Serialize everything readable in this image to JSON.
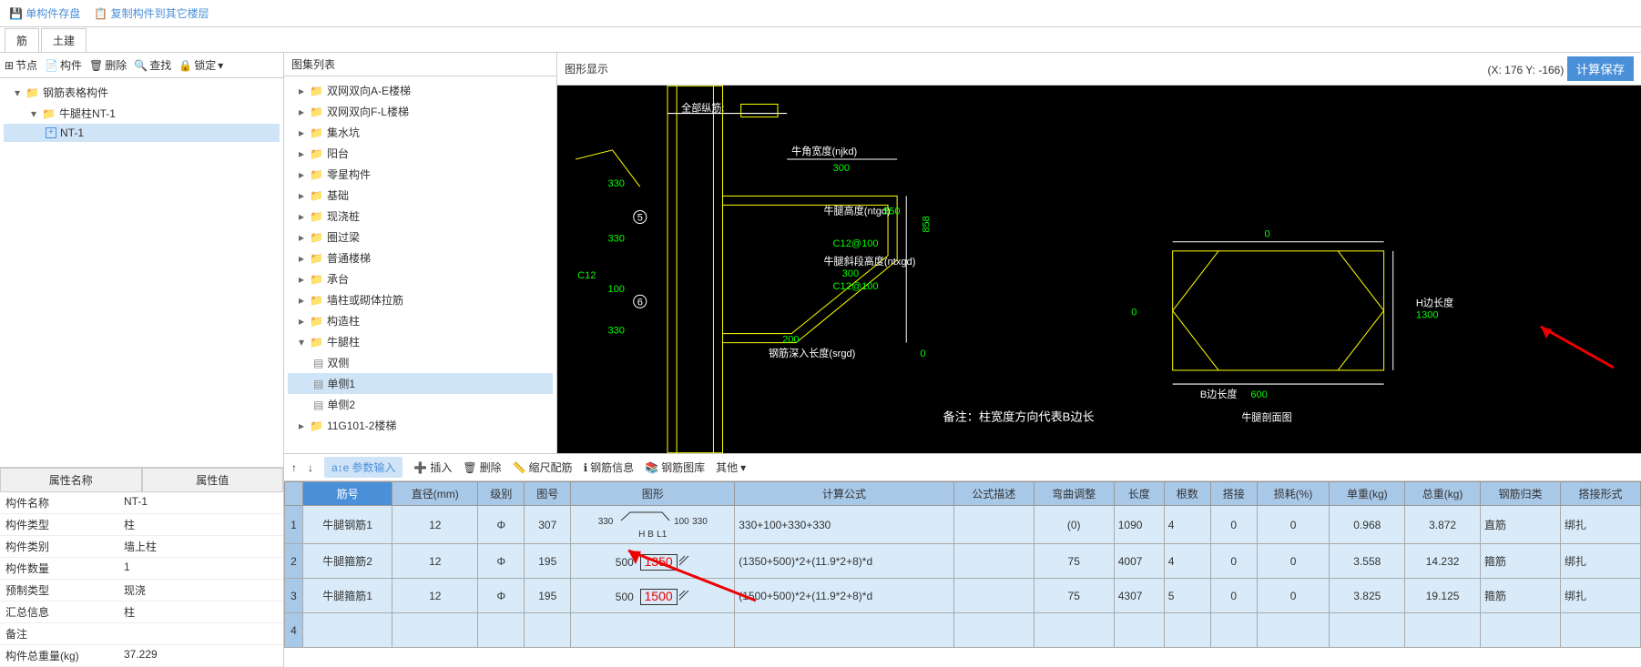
{
  "top_bar": {
    "save": "单构件存盘",
    "copy": "复制构件到其它楼层"
  },
  "tabs": {
    "rebar": "筋",
    "civil": "土建"
  },
  "toolbar": {
    "node": "节点",
    "component": "构件",
    "delete": "删除",
    "search": "查找",
    "lock": "锁定"
  },
  "left_tree": {
    "root": "钢筋表格构件",
    "child1": "牛腿柱NT-1",
    "leaf": "NT-1"
  },
  "props": {
    "header_name": "属性名称",
    "header_value": "属性值",
    "rows": [
      {
        "name": "构件名称",
        "value": "NT-1"
      },
      {
        "name": "构件类型",
        "value": "柱"
      },
      {
        "name": "构件类别",
        "value": "墙上柱"
      },
      {
        "name": "构件数量",
        "value": "1"
      },
      {
        "name": "预制类型",
        "value": "现浇"
      },
      {
        "name": "汇总信息",
        "value": "柱"
      },
      {
        "name": "备注",
        "value": ""
      },
      {
        "name": "构件总重量(kg)",
        "value": "37.229"
      }
    ]
  },
  "atlas": {
    "title": "图集列表",
    "items": [
      "双网双向A-E楼梯",
      "双网双向F-L楼梯",
      "集水坑",
      "阳台",
      "零星构件",
      "基础",
      "现浇桩",
      "圈过梁",
      "普通楼梯",
      "承台",
      "墙柱或砌体拉筋",
      "构造柱"
    ],
    "niutui": "牛腿柱",
    "niutui_children": [
      "双侧",
      "单侧1",
      "单侧2"
    ],
    "last": "11G101-2楼梯"
  },
  "graphics": {
    "title": "图形显示",
    "coords": "(X: 176 Y: -166)",
    "calc_btn": "计算保存",
    "labels": {
      "all_rebar": "全部纵筋:",
      "njkd": "牛角宽度(njkd)",
      "njkd_val": "300",
      "ntgd": "牛腿高度(ntgd)",
      "ntgd_val": "550",
      "ntxgd": "牛腿斜段高度(ntxgd)",
      "ntxgd_val": "300",
      "srgd": "钢筋深入长度(srgd)",
      "c12_100_a": "C12@100",
      "c12_100_b": "C12@100",
      "c12": "C12",
      "v330_1": "330",
      "v330_2": "330",
      "v330_3": "330",
      "v330_4": "330",
      "v100": "100",
      "v200": "200",
      "v850": "858",
      "v0": "0",
      "b_len": "B边长度",
      "b_val": "600",
      "h_len": "H边长度",
      "h_val": "1300",
      "section": "牛腿剖面图",
      "note": "备注：柱宽度方向代表B边长"
    }
  },
  "lower_toolbar": {
    "param": "参数输入",
    "insert": "插入",
    "delete": "删除",
    "scale": "缩尺配筋",
    "info": "钢筋信息",
    "lib": "钢筋图库",
    "other": "其他"
  },
  "table": {
    "headers": [
      "筋号",
      "直径(mm)",
      "级别",
      "图号",
      "图形",
      "计算公式",
      "公式描述",
      "弯曲调整",
      "长度",
      "根数",
      "搭接",
      "损耗(%)",
      "单重(kg)",
      "总重(kg)",
      "钢筋归类",
      "搭接形式"
    ],
    "rows": [
      {
        "n": "1",
        "name": "牛腿钢筋1",
        "dia": "12",
        "grade": "Φ",
        "fig": "307",
        "shape": {
          "t": "330",
          "t2": "100",
          "t3": "330",
          "hb": "H\nB",
          "l1": "L1"
        },
        "formula": "330+100+330+330",
        "desc": "",
        "bend": "(0)",
        "len": "1090",
        "qty": "4",
        "lap": "0",
        "loss": "0",
        "uw": "0.968",
        "tw": "3.872",
        "cat": "直筋",
        "form": "绑扎"
      },
      {
        "n": "2",
        "name": "牛腿箍筋2",
        "dia": "12",
        "grade": "Φ",
        "fig": "195",
        "shape": {
          "a": "500",
          "b": "1350"
        },
        "formula": "(1350+500)*2+(11.9*2+8)*d",
        "desc": "",
        "bend": "75",
        "len": "4007",
        "qty": "4",
        "lap": "0",
        "loss": "0",
        "uw": "3.558",
        "tw": "14.232",
        "cat": "箍筋",
        "form": "绑扎"
      },
      {
        "n": "3",
        "name": "牛腿箍筋1",
        "dia": "12",
        "grade": "Φ",
        "fig": "195",
        "shape": {
          "a": "500",
          "b": "1500"
        },
        "formula": "(1500+500)*2+(11.9*2+8)*d",
        "desc": "",
        "bend": "75",
        "len": "4307",
        "qty": "5",
        "lap": "0",
        "loss": "0",
        "uw": "3.825",
        "tw": "19.125",
        "cat": "箍筋",
        "form": "绑扎"
      }
    ]
  }
}
